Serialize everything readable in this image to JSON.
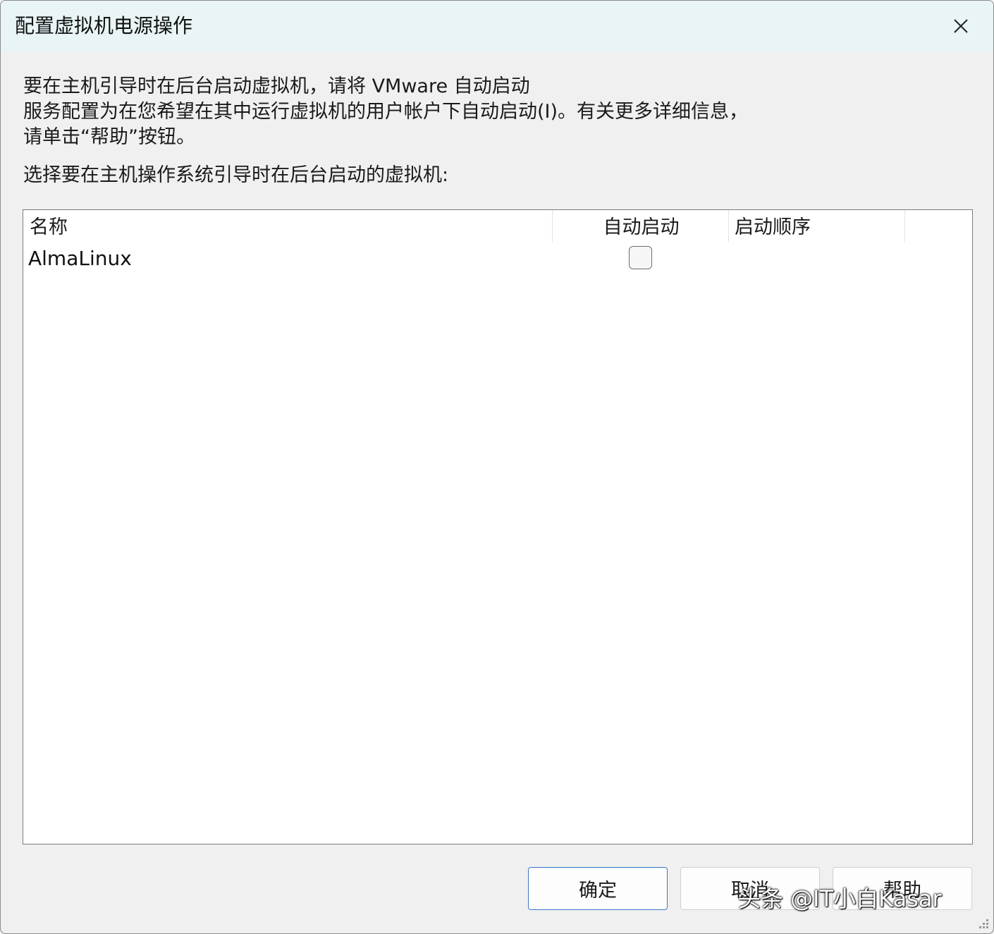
{
  "window": {
    "title": "配置虚拟机电源操作"
  },
  "description": {
    "lines": [
      "要在主机引导时在后台启动虚拟机，请将 VMware 自动启动",
      "服务配置为在您希望在其中运行虚拟机的用户帐户下自动启动(I)。有关更多详细信息，",
      "请单击“帮助”按钮。"
    ]
  },
  "prompt": "选择要在主机操作系统引导时在后台启动的虚拟机:",
  "list": {
    "columns": {
      "name": "名称",
      "autostart": "自动启动",
      "order": "启动顺序"
    },
    "rows": [
      {
        "name": "AlmaLinux",
        "autostart_checked": false,
        "order": ""
      }
    ]
  },
  "buttons": {
    "ok": "确定",
    "cancel": "取消",
    "help": "帮助"
  },
  "watermark": "头条 @IT小白Kasar",
  "icons": {
    "close": "close-icon",
    "resize": "resize-grip-icon"
  }
}
